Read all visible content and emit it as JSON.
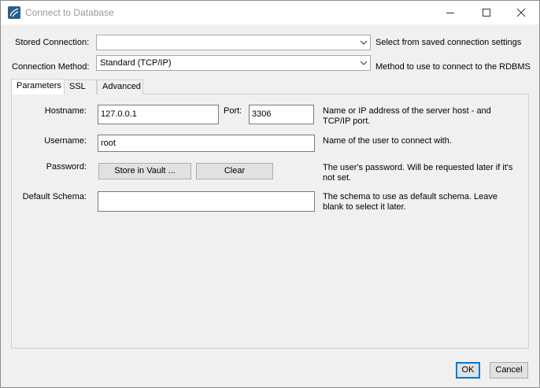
{
  "window": {
    "title": "Connect to Database"
  },
  "stored_connection": {
    "label": "Stored Connection:",
    "value": "",
    "help": "Select from saved connection settings"
  },
  "connection_method": {
    "label": "Connection Method:",
    "value": "Standard (TCP/IP)",
    "help": "Method to use to connect to the RDBMS"
  },
  "tabs": [
    {
      "label": "Parameters",
      "active": true
    },
    {
      "label": "SSL",
      "active": false
    },
    {
      "label": "Advanced",
      "active": false
    }
  ],
  "parameters": {
    "hostname": {
      "label": "Hostname:",
      "value": "127.0.0.1",
      "help": [
        "Name or IP address of the server host - and",
        "TCP/IP port."
      ]
    },
    "port": {
      "label": "Port:",
      "value": "3306"
    },
    "username": {
      "label": "Username:",
      "value": "root",
      "help": "Name of the user to connect with."
    },
    "password": {
      "label": "Password:",
      "store_button": "Store in Vault ...",
      "clear_button": "Clear",
      "help": [
        "The user's password. Will be requested later if it's",
        "not set."
      ]
    },
    "default_schema": {
      "label": "Default Schema:",
      "value": "",
      "help": [
        "The schema to use as default schema. Leave",
        "blank to select it later."
      ]
    }
  },
  "footer": {
    "ok_label": "OK",
    "cancel_label": "Cancel"
  },
  "icons": {
    "app": "mysql-workbench-icon",
    "minimize": "minimize-icon",
    "maximize": "maximize-icon",
    "close": "close-icon",
    "dropdown": "chevron-down-icon"
  }
}
